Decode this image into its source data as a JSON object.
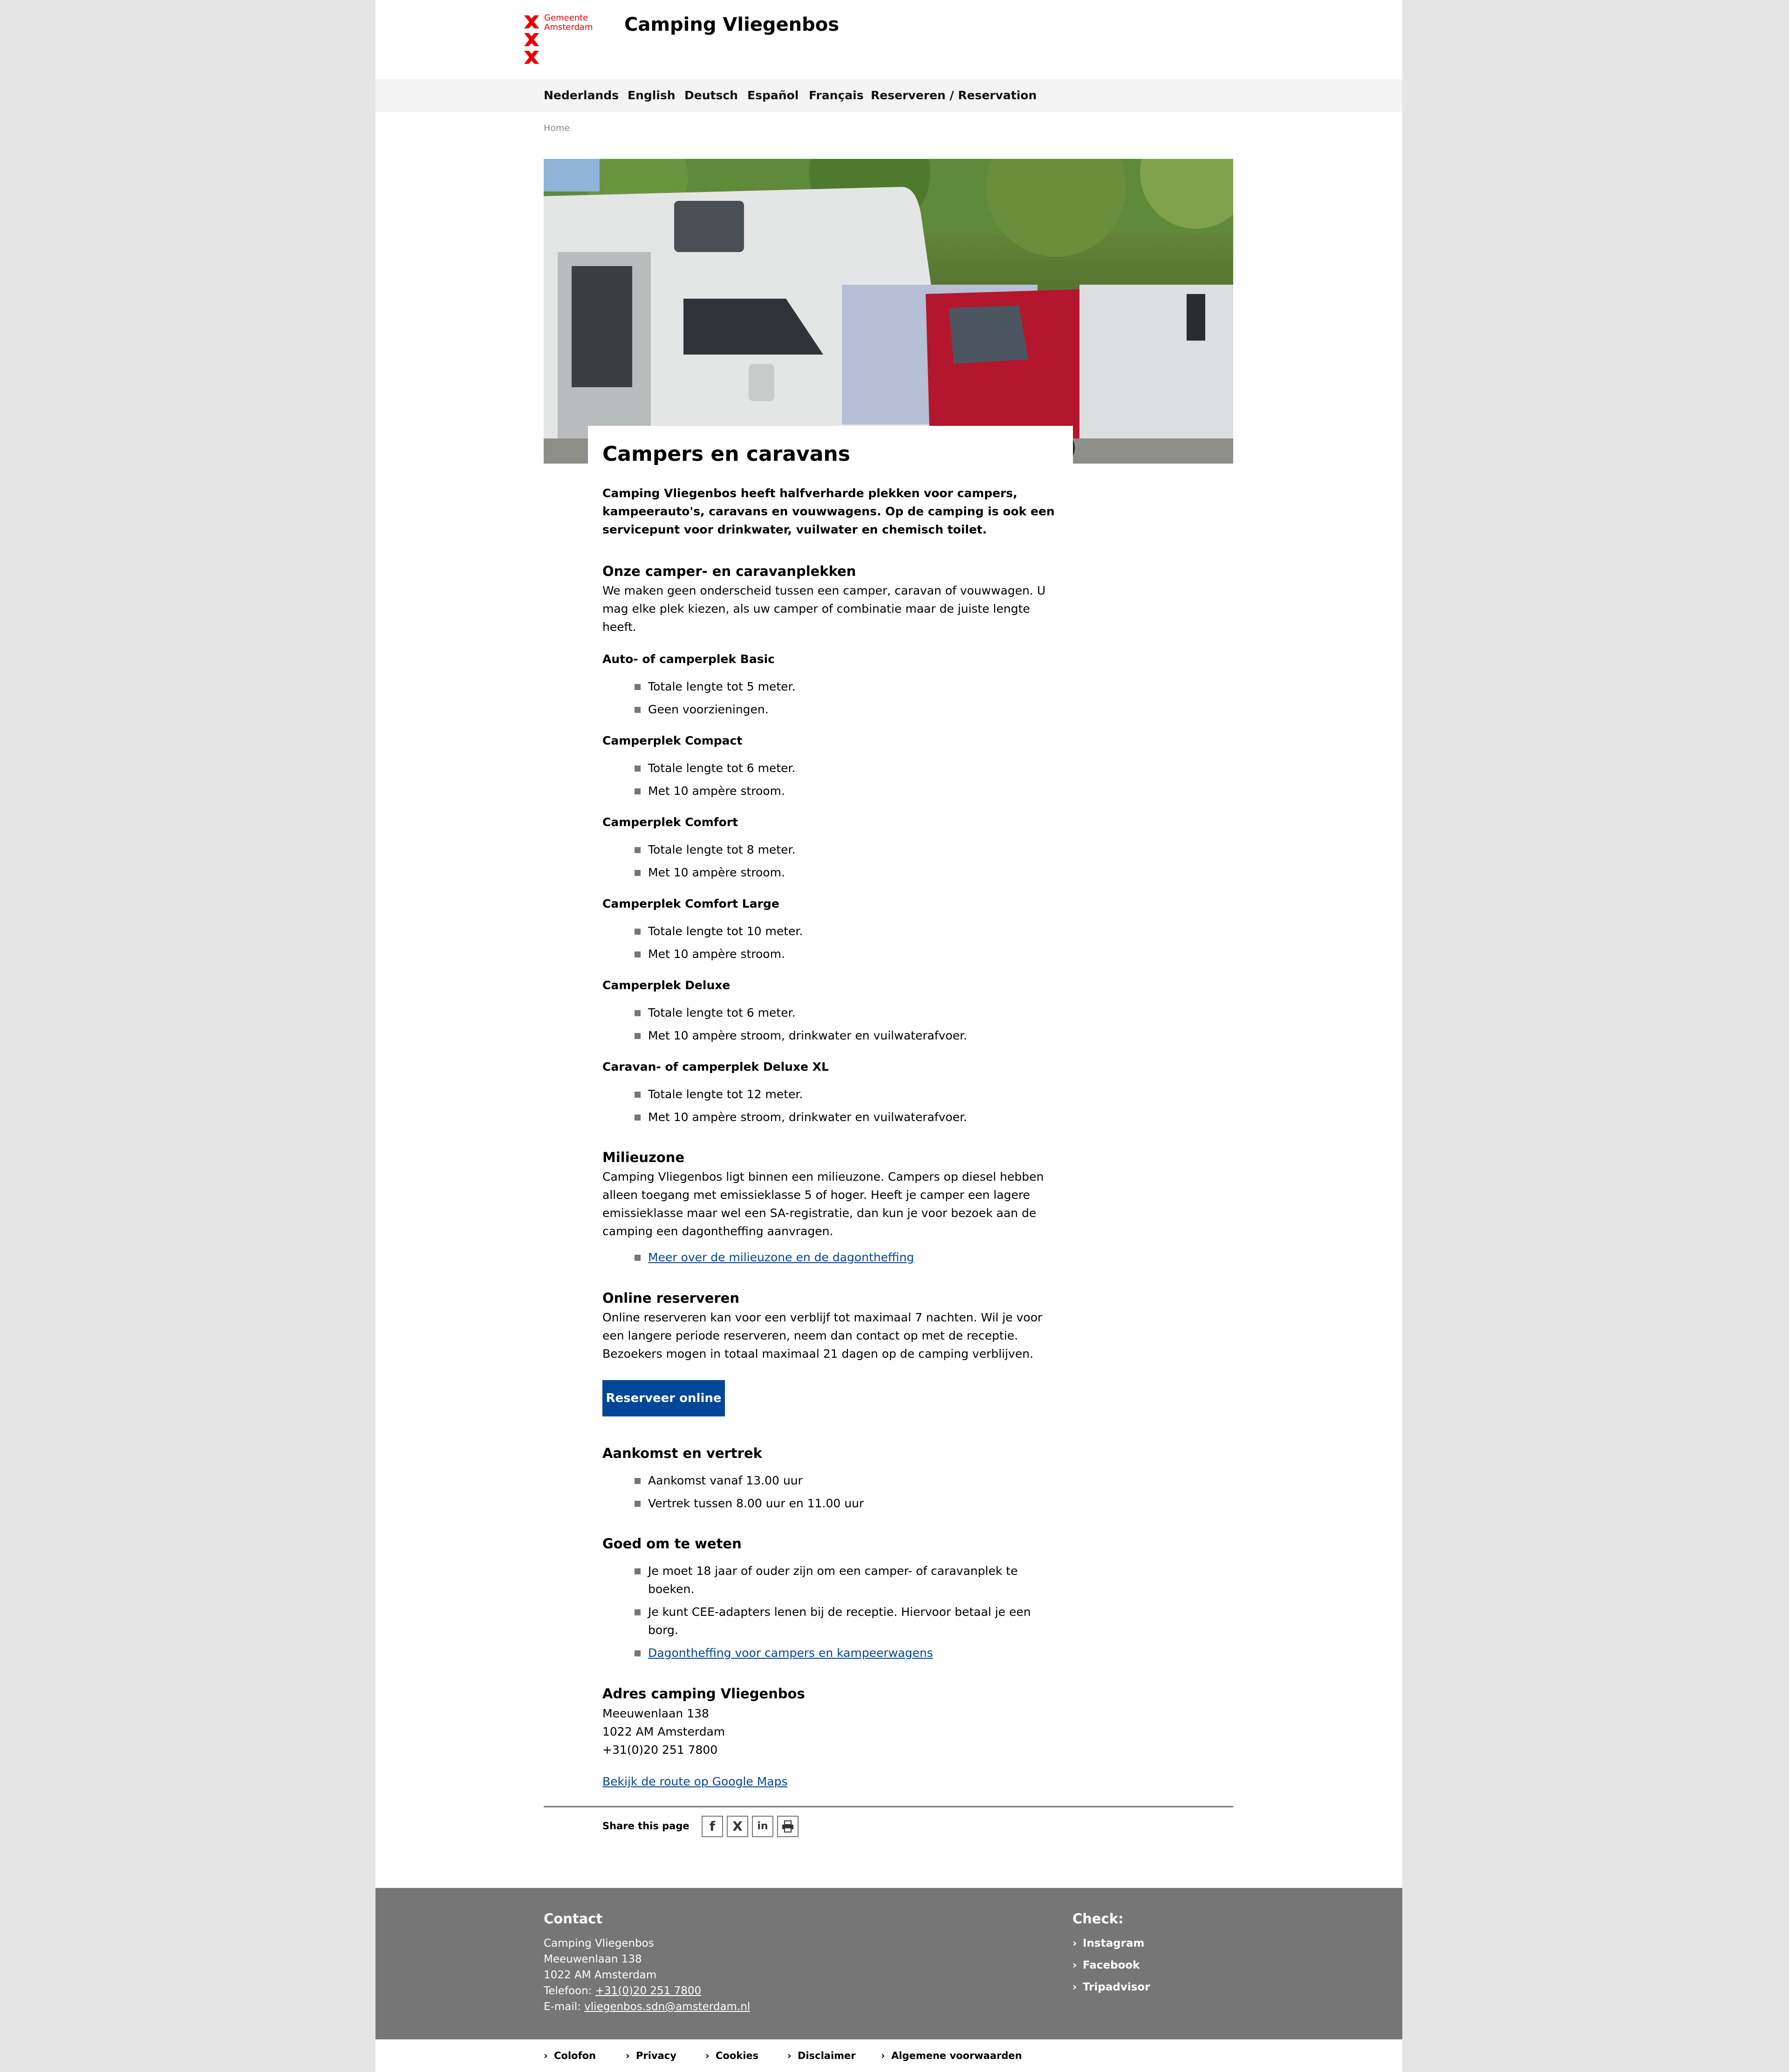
{
  "brand": {
    "logo_text_line1": "Gemeente",
    "logo_text_line2": "Amsterdam",
    "site_title": "Camping Vliegenbos",
    "accent_color": "#ec0000",
    "link_color": "#004699"
  },
  "nav": {
    "items": [
      "Nederlands",
      "English",
      "Deutsch",
      "Español",
      "Français",
      "Reserveren / Reservation"
    ]
  },
  "breadcrumb": {
    "home": "Home"
  },
  "hero": {
    "image_alt": "Campers op de camping tussen de bomen"
  },
  "page": {
    "title": "Campers en caravans",
    "lead": "Camping Vliegenbos heeft halfverharde plekken voor campers, kampeerauto's, caravans en vouwwagens. Op de camping is ook een servicepunt voor drinkwater, vuilwater en chemisch toilet."
  },
  "sections": {
    "plekken": {
      "heading": "Onze camper- en caravanplekken",
      "text": "We maken geen onderscheid tussen een camper, caravan of vouwwagen. U mag elke plek kiezen, als uw camper of combinatie maar de juiste lengte heeft.",
      "types": [
        {
          "name": "Auto- of camperplek Basic",
          "items": [
            "Totale lengte tot 5 meter.",
            "Geen voorzieningen."
          ]
        },
        {
          "name": "Camperplek Compact",
          "items": [
            "Totale lengte tot 6 meter.",
            "Met 10 ampère stroom."
          ]
        },
        {
          "name": "Camperplek Comfort",
          "items": [
            "Totale lengte tot 8 meter.",
            "Met 10 ampère stroom."
          ]
        },
        {
          "name": "Camperplek Comfort Large",
          "items": [
            "Totale lengte tot 10 meter.",
            "Met 10 ampère stroom."
          ]
        },
        {
          "name": "Camperplek Deluxe",
          "items": [
            "Totale lengte tot 6 meter.",
            "Met 10 ampère stroom, drinkwater en vuilwaterafvoer."
          ]
        },
        {
          "name": "Caravan- of camperplek  Deluxe XL",
          "items": [
            "Totale lengte tot 12 meter.",
            "Met 10 ampère stroom, drinkwater en vuilwaterafvoer."
          ]
        }
      ]
    },
    "milieuzone": {
      "heading": "Milieuzone",
      "text": "Camping Vliegenbos ligt binnen een milieuzone. Campers op diesel hebben alleen toegang met emissieklasse 5 of hoger. Heeft je camper een lagere emissieklasse maar wel een SA-registratie, dan kun je voor bezoek aan de camping een dagontheffing aanvragen.",
      "link": "Meer over de milieuzone en de dagontheffing"
    },
    "reserveren": {
      "heading": "Online reserveren",
      "text": "Online reserveren kan voor een verblijf tot maximaal 7 nachten. Wil je voor een langere periode reserveren, neem dan contact op met de receptie. Bezoekers mogen in totaal maximaal 21 dagen op de camping verblijven.",
      "button": "Reserveer online"
    },
    "aankomst": {
      "heading": "Aankomst en vertrek",
      "items": [
        "Aankomst vanaf 13.00 uur",
        "Vertrek tussen 8.00 uur en 11.00 uur"
      ]
    },
    "goed": {
      "heading": "Goed om te weten",
      "items": [
        "Je moet 18 jaar of ouder zijn om een camper- of caravanplek te boeken.",
        "Je kunt CEE-adapters lenen bij de receptie. Hiervoor betaal je een borg."
      ],
      "link": "Dagontheffing voor campers en kampeerwagens"
    },
    "adres": {
      "heading": "Adres camping Vliegenbos",
      "street": "Meeuwenlaan 138",
      "city": "1022 AM Amsterdam",
      "phone": "+31(0)20 251 7800",
      "route_link": "Bekijk de route op Google Maps"
    }
  },
  "share": {
    "label": "Share this page",
    "icons": [
      "facebook-icon",
      "x-icon",
      "linkedin-icon",
      "print-icon"
    ]
  },
  "footer": {
    "contact_heading": "Contact",
    "name": "Camping Vliegenbos",
    "street": "Meeuwenlaan 138",
    "city": "1022 AM Amsterdam",
    "phone_label": "Telefoon: ",
    "phone": "+31(0)20 251 7800",
    "email_label": "E-mail: ",
    "email": "vliegenbos.sdn@amsterdam.nl",
    "check_heading": "Check:",
    "check_links": [
      "Instagram",
      "Facebook",
      "Tripadvisor"
    ],
    "bottom_links": [
      "Colofon",
      "Privacy",
      "Cookies",
      "Disclaimer",
      "Algemene voorwaarden"
    ]
  }
}
